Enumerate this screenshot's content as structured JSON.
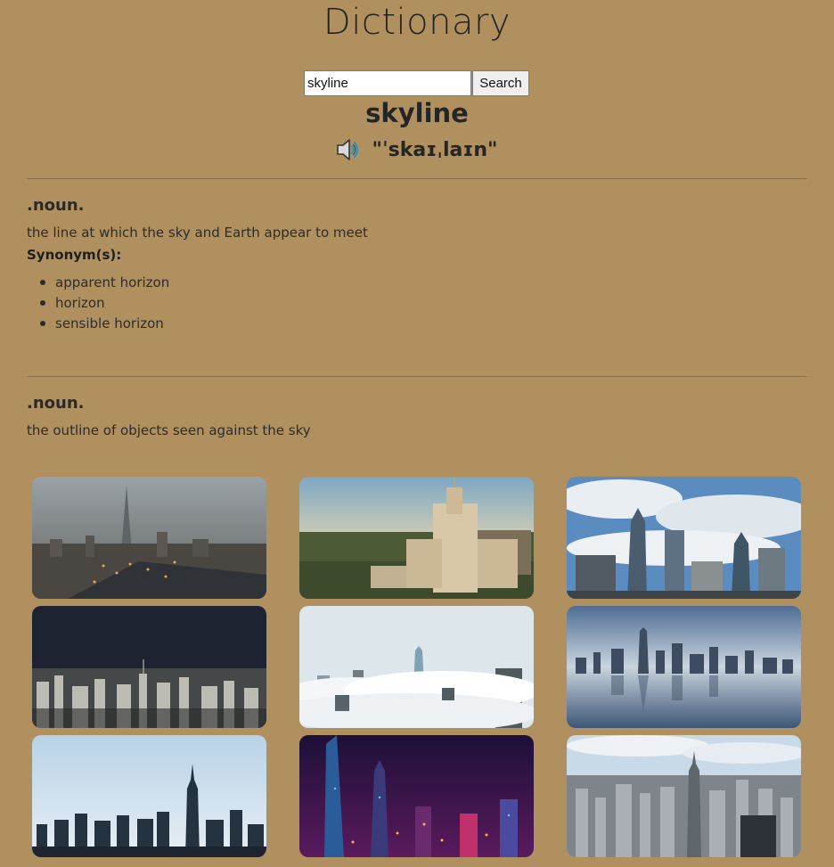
{
  "header": {
    "title": "Dictionary"
  },
  "search": {
    "value": "skyline",
    "button_label": "Search"
  },
  "entry": {
    "word": "skyline",
    "phonetic": "\"ˈskaɪˌlaɪn\"",
    "meanings": [
      {
        "part_of_speech": ".noun.",
        "definition": "the line at which the sky and Earth appear to meet",
        "synonyms_label": "Synonym(s):",
        "synonyms": [
          "apparent horizon",
          "horizon",
          "sensible horizon"
        ]
      },
      {
        "part_of_speech": ".noun.",
        "definition": "the outline of objects seen against the sky"
      }
    ]
  },
  "gallery": {
    "images": [
      {
        "name": "foggy-city-tower-photo"
      },
      {
        "name": "university-tower-photo"
      },
      {
        "name": "blue-sky-towers-photo"
      },
      {
        "name": "dark-city-sprawl-photo"
      },
      {
        "name": "city-above-clouds-photo"
      },
      {
        "name": "reflected-skyline-photo"
      },
      {
        "name": "empire-state-skyline-photo"
      },
      {
        "name": "neon-night-city-photo"
      },
      {
        "name": "aerial-manhattan-photo"
      }
    ]
  },
  "colors": {
    "background": "#b0905e",
    "text": "#252525",
    "divider": "#8c7146"
  }
}
